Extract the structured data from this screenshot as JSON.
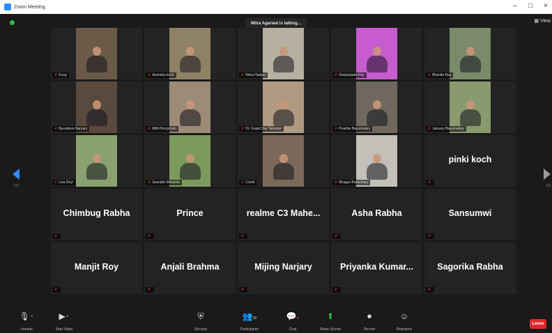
{
  "window": {
    "title": "Zoom Meeting",
    "controls": [
      "–",
      "□",
      "×"
    ]
  },
  "banner": {
    "talking": "Mitra Agarwal is talking..."
  },
  "view_label": "View",
  "pages": {
    "left": "1/2",
    "right": "1/2"
  },
  "colors": {
    "accent": "#2d8cff",
    "muted": "#e02828",
    "leave": "#e02828",
    "background": "#1a1a1a",
    "tile": "#232323"
  },
  "participants": [
    {
      "label": "Fung",
      "video": true,
      "bg": "#6b5a48"
    },
    {
      "label": "Anamika koch",
      "video": true,
      "bg": "#8f8166"
    },
    {
      "label": "Rima Harijan",
      "video": true,
      "bg": "#b6b0a0"
    },
    {
      "label": "Deepanjalia Ray",
      "video": true,
      "bg": "#c75bd0"
    },
    {
      "label": "Bhanita Ray",
      "video": true,
      "bg": "#7a8a6a"
    },
    {
      "label": "Basudeva Narzary",
      "video": true,
      "bg": "#5a4a3e"
    },
    {
      "label": "Mithi Borgohain",
      "video": true,
      "bg": "#9b8b77"
    },
    {
      "label": "Dr. Gopal Das Talukdar",
      "video": true,
      "bg": "#b09a82"
    },
    {
      "label": "Pearlita Basumatary",
      "video": true,
      "bg": "#70685e"
    },
    {
      "label": "January Basumatary",
      "video": true,
      "bg": "#8a9a6e"
    },
    {
      "label": "Lisa Deyi",
      "video": true,
      "bg": "#8aa070"
    },
    {
      "label": "Saurabh Mahanta",
      "video": true,
      "bg": "#7d9a5e"
    },
    {
      "label": "Comit",
      "video": true,
      "bg": "#7b6a5a"
    },
    {
      "label": "Bhagya Ramchiary",
      "video": true,
      "bg": "#c2c0b8"
    },
    {
      "name": "pinki koch",
      "video": false
    },
    {
      "name": "Chimbug Rabha",
      "video": false
    },
    {
      "name": "Prince",
      "video": false
    },
    {
      "name": "realme C3 Mahe...",
      "video": false
    },
    {
      "name": "Asha Rabha",
      "video": false
    },
    {
      "name": "Sansumwi",
      "video": false
    },
    {
      "name": "Manjit Roy",
      "video": false
    },
    {
      "name": "Anjali Brahma",
      "video": false
    },
    {
      "name": "Mijing Narjary",
      "video": false
    },
    {
      "name": "Priyanka Kumar...",
      "video": false
    },
    {
      "name": "Sagorika Rabha",
      "video": false
    }
  ],
  "toolbar": {
    "unmute": "Unmute",
    "start_video": "Start Video",
    "security": "Security",
    "participants": "Participants",
    "participants_count": "32",
    "chat": "Chat",
    "share_screen": "Share Screen",
    "record": "Record",
    "reactions": "Reactions",
    "leave": "Leave"
  }
}
